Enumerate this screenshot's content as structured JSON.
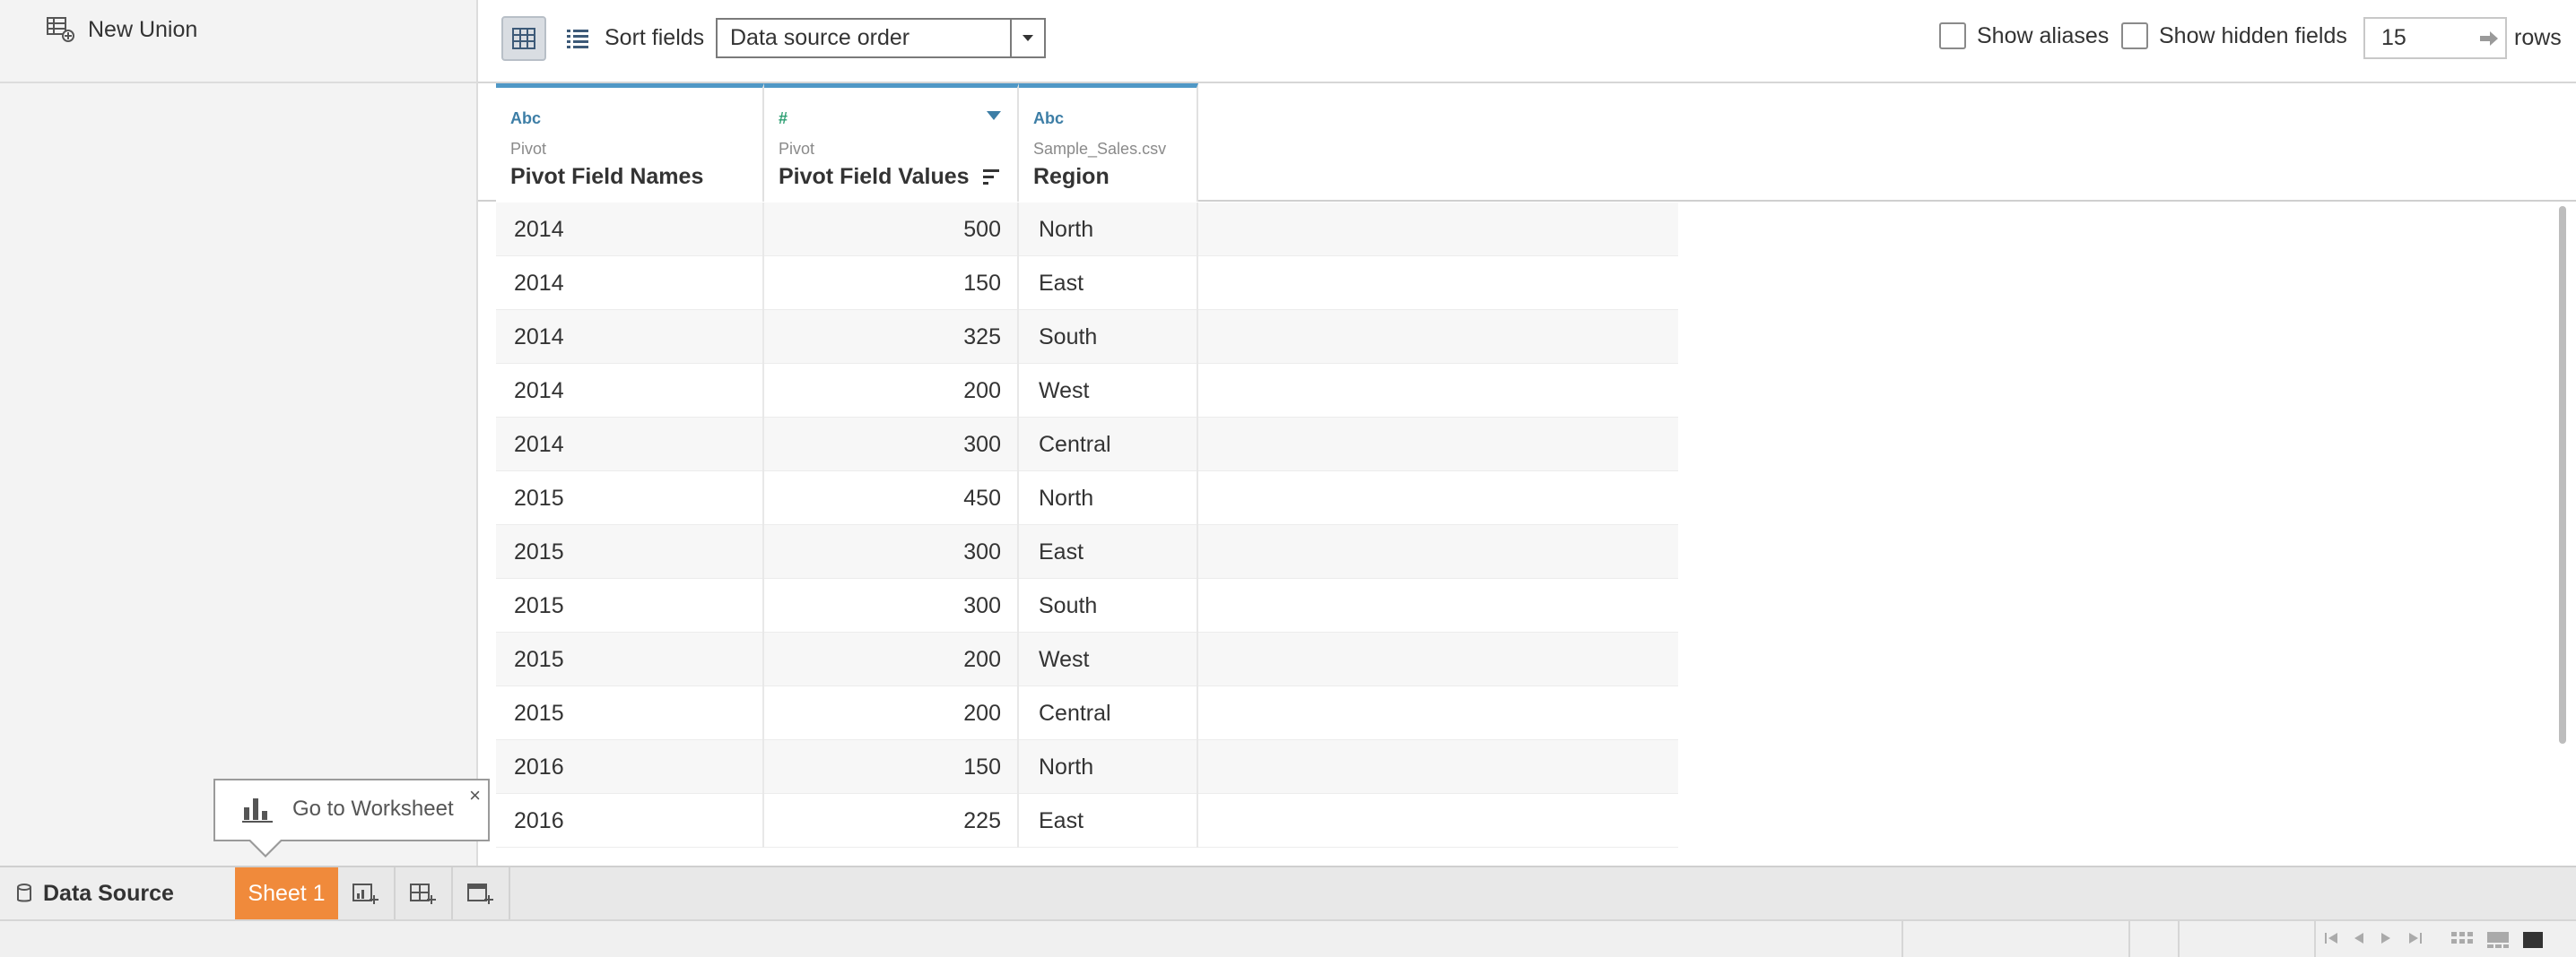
{
  "left_panel": {
    "new_union_label": "New Union"
  },
  "toolbar": {
    "sort_label": "Sort fields",
    "sort_value": "Data source order",
    "show_aliases_label": "Show aliases",
    "show_hidden_label": "Show hidden fields",
    "rows_value": "15",
    "rows_label": "rows"
  },
  "columns": [
    {
      "type": "Abc",
      "source": "Pivot",
      "name": "Pivot Field Names"
    },
    {
      "type": "#",
      "source": "Pivot",
      "name": "Pivot Field Values"
    },
    {
      "type": "Abc",
      "source": "Sample_Sales.csv",
      "name": "Region"
    }
  ],
  "rows": [
    {
      "year": "2014",
      "value": "500",
      "region": "North"
    },
    {
      "year": "2014",
      "value": "150",
      "region": "East"
    },
    {
      "year": "2014",
      "value": "325",
      "region": "South"
    },
    {
      "year": "2014",
      "value": "200",
      "region": "West"
    },
    {
      "year": "2014",
      "value": "300",
      "region": "Central"
    },
    {
      "year": "2015",
      "value": "450",
      "region": "North"
    },
    {
      "year": "2015",
      "value": "300",
      "region": "East"
    },
    {
      "year": "2015",
      "value": "300",
      "region": "South"
    },
    {
      "year": "2015",
      "value": "200",
      "region": "West"
    },
    {
      "year": "2015",
      "value": "200",
      "region": "Central"
    },
    {
      "year": "2016",
      "value": "150",
      "region": "North"
    },
    {
      "year": "2016",
      "value": "225",
      "region": "East"
    }
  ],
  "tabs": {
    "data_source_label": "Data Source",
    "sheet_label": "Sheet 1"
  },
  "tooltip": {
    "label": "Go to Worksheet",
    "close": "×"
  },
  "colors": {
    "accent_blue": "#4f98c6",
    "sheet_tab_orange": "#f08a3b"
  }
}
